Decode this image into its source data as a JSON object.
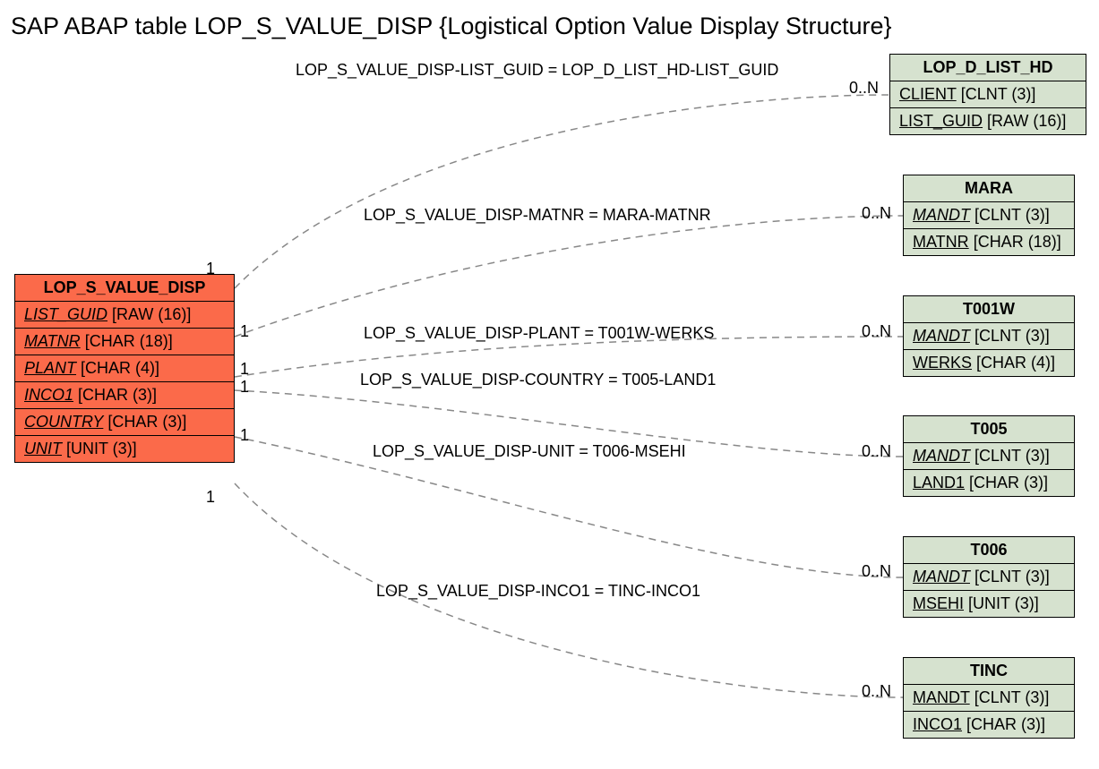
{
  "title": "SAP ABAP table LOP_S_VALUE_DISP {Logistical Option Value Display Structure}",
  "main_entity": {
    "name": "LOP_S_VALUE_DISP",
    "fields": [
      {
        "name": "LIST_GUID",
        "type": "[RAW (16)]"
      },
      {
        "name": "MATNR",
        "type": "[CHAR (18)]"
      },
      {
        "name": "PLANT",
        "type": "[CHAR (4)]"
      },
      {
        "name": "INCO1",
        "type": "[CHAR (3)]"
      },
      {
        "name": "COUNTRY",
        "type": "[CHAR (3)]"
      },
      {
        "name": "UNIT",
        "type": "[UNIT (3)]"
      }
    ]
  },
  "targets": [
    {
      "name": "LOP_D_LIST_HD",
      "f1": {
        "name": "CLIENT",
        "noital": true,
        "type": "[CLNT (3)]"
      },
      "f2": {
        "name": "LIST_GUID",
        "noital": true,
        "type": "[RAW (16)]"
      }
    },
    {
      "name": "MARA",
      "f1": {
        "name": "MANDT",
        "type": "[CLNT (3)]"
      },
      "f2": {
        "name": "MATNR",
        "noital": true,
        "type": "[CHAR (18)]"
      }
    },
    {
      "name": "T001W",
      "f1": {
        "name": "MANDT",
        "type": "[CLNT (3)]"
      },
      "f2": {
        "name": "WERKS",
        "noital": true,
        "type": "[CHAR (4)]"
      }
    },
    {
      "name": "T005",
      "f1": {
        "name": "MANDT",
        "type": "[CLNT (3)]"
      },
      "f2": {
        "name": "LAND1",
        "noital": true,
        "type": "[CHAR (3)]"
      }
    },
    {
      "name": "T006",
      "f1": {
        "name": "MANDT",
        "type": "[CLNT (3)]"
      },
      "f2": {
        "name": "MSEHI",
        "noital": true,
        "type": "[UNIT (3)]"
      }
    },
    {
      "name": "TINC",
      "f1": {
        "name": "MANDT",
        "noital": true,
        "type": "[CLNT (3)]"
      },
      "f2": {
        "name": "INCO1",
        "noital": true,
        "type": "[CHAR (3)]"
      }
    }
  ],
  "relations": [
    {
      "label": "LOP_S_VALUE_DISP-LIST_GUID = LOP_D_LIST_HD-LIST_GUID",
      "left_card": "1",
      "right_card": "0..N"
    },
    {
      "label": "LOP_S_VALUE_DISP-MATNR = MARA-MATNR",
      "left_card": "1",
      "right_card": "0..N"
    },
    {
      "label": "LOP_S_VALUE_DISP-PLANT = T001W-WERKS",
      "left_card": "1",
      "right_card": "0..N"
    },
    {
      "label": "LOP_S_VALUE_DISP-COUNTRY = T005-LAND1",
      "left_card": "1",
      "right_card": "0..N"
    },
    {
      "label": "LOP_S_VALUE_DISP-UNIT = T006-MSEHI",
      "left_card": "1",
      "right_card": "0..N"
    },
    {
      "label": "LOP_S_VALUE_DISP-INCO1 = TINC-INCO1",
      "left_card": "1",
      "right_card": "0..N"
    }
  ]
}
